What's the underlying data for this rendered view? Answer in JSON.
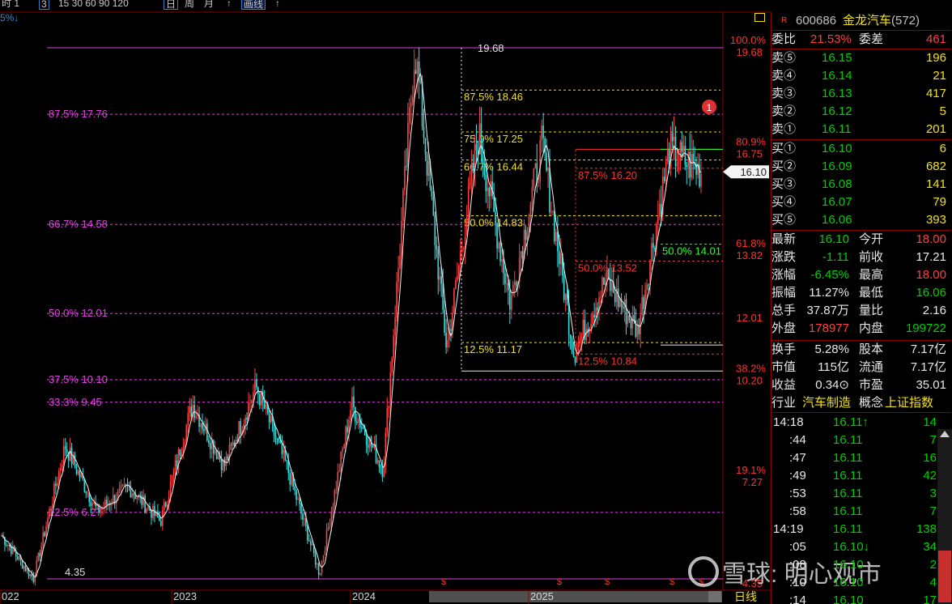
{
  "toolbar": {
    "left_label": "时  1",
    "period_3": "3",
    "periods": "15 30 60 90 120",
    "period_day": "日",
    "period_week": "周",
    "period_month": "月",
    "more": "↑",
    "box_label": "画线",
    "more2": "↑",
    "pct": "5%↓"
  },
  "colors": {
    "up": "#ff4040",
    "down": "#30e0e0",
    "fib_magenta": "#e040e0",
    "fib_yellow": "#f0e020",
    "fib_red": "#ff3030",
    "fib_green": "#30ff30",
    "panel_border": "#8b0000"
  },
  "chart_data": {
    "type": "candlestick",
    "period_label": "日线",
    "x_tick_labels": [
      "022",
      "2023",
      "2024",
      "2025"
    ],
    "price_high_label": "19.68",
    "price_low_label": "4.35",
    "current_price_tag": "16.10",
    "alert_badge": "1",
    "right_axis": [
      {
        "pct": "100.0%",
        "price": "19.68"
      },
      {
        "pct": "80.9%",
        "price": "16.75"
      },
      {
        "pct": "61.8%",
        "price": "13.82"
      },
      {
        "pct": "",
        "price": "12.01"
      },
      {
        "pct": "38.2%",
        "price": "10.20"
      },
      {
        "pct": "19.1%",
        "price": "7.27"
      },
      {
        "pct": "",
        "price": "4.35"
      }
    ],
    "fib_magenta": [
      {
        "label": "87.5% 17.76",
        "price": 17.76
      },
      {
        "label": "66.7% 14.58",
        "price": 14.58
      },
      {
        "label": "50.0% 12.01",
        "price": 12.01
      },
      {
        "label": "37.5% 10.10",
        "price": 10.1
      },
      {
        "label": "33.3% 9.45",
        "price": 9.45
      },
      {
        "label": "12.5% 6.27",
        "price": 6.27
      }
    ],
    "fib_yellow": [
      {
        "label": "87.5% 18.46",
        "price": 18.46
      },
      {
        "label": "75.0% 17.25",
        "price": 17.25
      },
      {
        "label": "66.7% 16.44",
        "price": 16.44
      },
      {
        "label": "50.0% 14.83",
        "price": 14.83
      },
      {
        "label": "12.5% 11.17",
        "price": 11.17
      }
    ],
    "fib_red": [
      {
        "label": "87.5% 16.20",
        "price": 16.2
      },
      {
        "label": "50.0% 13.52",
        "price": 13.52
      },
      {
        "label": "12.5% 10.84",
        "price": 10.84
      }
    ],
    "fib_green": [
      {
        "label": "50.0% 14.01",
        "price": 14.01
      }
    ],
    "anchors": [
      {
        "year": "2022",
        "close": 5.6
      },
      {
        "year": "2022",
        "close": 4.35
      },
      {
        "year": "2022",
        "close": 8.2
      },
      {
        "year": "2022",
        "close": 6.3
      },
      {
        "year": "2022",
        "close": 7.0
      },
      {
        "year": "2022",
        "close": 6.0
      },
      {
        "year": "2023",
        "close": 9.4
      },
      {
        "year": "2023",
        "close": 7.6
      },
      {
        "year": "2023",
        "close": 9.9
      },
      {
        "year": "2023",
        "close": 7.5
      },
      {
        "year": "2024",
        "close": 4.5
      },
      {
        "year": "2024",
        "close": 9.4
      },
      {
        "year": "2024",
        "close": 7.5
      },
      {
        "year": "2024",
        "close": 19.68
      },
      {
        "year": "2024",
        "close": 11.0
      },
      {
        "year": "2024",
        "close": 17.2
      },
      {
        "year": "2024",
        "close": 12.3
      },
      {
        "year": "2025",
        "close": 16.9
      },
      {
        "year": "2025",
        "close": 10.84
      },
      {
        "year": "2025",
        "close": 13.0
      },
      {
        "year": "2025",
        "close": 11.5
      },
      {
        "year": "2025",
        "close": 16.7
      },
      {
        "year": "2025",
        "close": 16.1
      }
    ]
  },
  "quote": {
    "code": "600686",
    "name": "金龙汽车",
    "rank": "(572)",
    "r_mark": "R",
    "weibi_label": "委比",
    "weibi": "21.53%",
    "weicha_label": "委差",
    "weicha": "461",
    "asks": [
      {
        "label": "卖⑤",
        "price": "16.15",
        "vol": "196"
      },
      {
        "label": "卖④",
        "price": "16.14",
        "vol": "21"
      },
      {
        "label": "卖③",
        "price": "16.13",
        "vol": "417"
      },
      {
        "label": "卖②",
        "price": "16.12",
        "vol": "5"
      },
      {
        "label": "卖①",
        "price": "16.11",
        "vol": "201"
      }
    ],
    "bids": [
      {
        "label": "买①",
        "price": "16.10",
        "vol": "6"
      },
      {
        "label": "买②",
        "price": "16.09",
        "vol": "682"
      },
      {
        "label": "买③",
        "price": "16.08",
        "vol": "141"
      },
      {
        "label": "买④",
        "price": "16.07",
        "vol": "79"
      },
      {
        "label": "买⑤",
        "price": "16.06",
        "vol": "393"
      }
    ],
    "stats": [
      {
        "l1": "最新",
        "v1": "16.10",
        "c1": "green",
        "l2": "今开",
        "v2": "18.00",
        "c2": "red"
      },
      {
        "l1": "涨跌",
        "v1": "-1.11",
        "c1": "green",
        "l2": "前收",
        "v2": "17.21",
        "c2": "white"
      },
      {
        "l1": "涨幅",
        "v1": "-6.45%",
        "c1": "green",
        "l2": "最高",
        "v2": "18.00",
        "c2": "red"
      },
      {
        "l1": "振幅",
        "v1": "11.27%",
        "c1": "white",
        "l2": "最低",
        "v2": "16.06",
        "c2": "green"
      },
      {
        "l1": "总手",
        "v1": "37.87万",
        "c1": "white",
        "l2": "量比",
        "v2": "2.16",
        "c2": "white"
      },
      {
        "l1": "外盘",
        "v1": "178977",
        "c1": "red",
        "l2": "内盘",
        "v2": "199722",
        "c2": "green"
      }
    ],
    "stats2": [
      {
        "l1": "换手",
        "v1": "5.28%",
        "l2": "股本",
        "v2": "7.17亿"
      },
      {
        "l1": "市值",
        "v1": "115亿",
        "l2": "流通",
        "v2": "7.17亿"
      },
      {
        "l1": "收益",
        "v1": "0.34⊙",
        "l2": "市盈",
        "v2": "35.01"
      }
    ],
    "industry_label": "行业",
    "industry": "汽车制造",
    "concept_label": "概念",
    "concept": "上证指数",
    "ticks": [
      {
        "time": "14:18",
        "price": "16.11↑",
        "vol": "14"
      },
      {
        "time": ":44",
        "price": "16.11",
        "vol": "7"
      },
      {
        "time": ":47",
        "price": "16.11",
        "vol": "16"
      },
      {
        "time": ":49",
        "price": "16.11",
        "vol": "42"
      },
      {
        "time": ":53",
        "price": "16.11",
        "vol": "3"
      },
      {
        "time": ":58",
        "price": "16.11",
        "vol": "7"
      },
      {
        "time": "14:19",
        "price": "16.11",
        "vol": "138"
      },
      {
        "time": ":05",
        "price": "16.10↓",
        "vol": "34"
      },
      {
        "time": ":08",
        "price": "16.10",
        "vol": "2"
      },
      {
        "time": ":10",
        "price": "16.10",
        "vol": "4"
      },
      {
        "time": ":14",
        "price": "16.10",
        "vol": "17"
      }
    ]
  },
  "watermark": "雪球: 明心观市"
}
